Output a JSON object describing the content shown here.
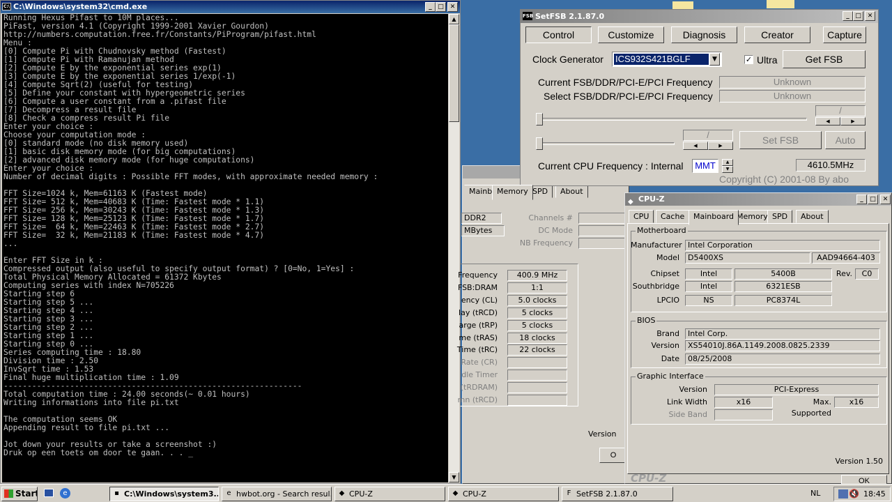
{
  "cmd": {
    "title": "C:\\Windows\\system32\\cmd.exe",
    "lines": [
      "Running Hexus Pifast to 10M places...",
      "PiFast, version 4.1 (Copyright 1999-2001 Xavier Gourdon)",
      "http://numbers.computation.free.fr/Constants/PiProgram/pifast.html",
      "Menu :",
      "[0] Compute Pi with Chudnovsky method (Fastest)",
      "[1] Compute Pi with Ramanujan method",
      "[2] Compute E by the exponential series exp(1)",
      "[3] Compute E by the exponential series 1/exp(-1)",
      "[4] Compute Sqrt(2) (useful for testing)",
      "[5] Define your constant with hypergeometric series",
      "[6] Compute a user constant from a .pifast file",
      "[7] Decompress a result file",
      "[8] Check a compress result Pi file",
      "Enter your choice :",
      "Choose your computation mode :",
      "[0] standard mode (no disk memory used)",
      "[1] basic disk memory mode (for big computations)",
      "[2] advanced disk memory mode (for huge computations)",
      "Enter your choice :",
      "Number of decimal digits : Possible FFT modes, with approximate needed memory :",
      "",
      "FFT Size=1024 k, Mem=61163 K (Fastest mode)",
      "FFT Size= 512 k, Mem=40683 K (Time: Fastest mode * 1.1)",
      "FFT Size= 256 k, Mem=30243 K (Time: Fastest mode * 1.3)",
      "FFT Size= 128 k, Mem=25123 K (Time: Fastest mode * 1.7)",
      "FFT Size=  64 k, Mem=22463 K (Time: Fastest mode * 2.7)",
      "FFT Size=  32 k, Mem=21183 K (Time: Fastest mode * 4.7)",
      "...",
      "",
      "Enter FFT Size in k :",
      "Compressed output (also useful to specify output format) ? [0=No, 1=Yes] :",
      "Total Physical Memory Allocated = 61372 Kbytes",
      "Computing series with index N=705226",
      "Starting step 6",
      "Starting step 5 ...",
      "Starting step 4 ...",
      "Starting step 3 ...",
      "Starting step 2 ...",
      "Starting step 1 ...",
      "Starting step 0 ...",
      "Series computing time : 18.80",
      "Division time : 2.50",
      "InvSqrt time : 1.53",
      "Final huge multiplication time : 1.09",
      "---------------------------------------------------------------",
      "Total computation time : 24.00 seconds(~ 0.01 hours)",
      "Writing informations into file pi.txt",
      "",
      "The computation seems OK",
      "Appending result to file pi.txt ...",
      "",
      "Jot down your results or take a screenshot :)",
      "Druk op een toets om door te gaan. . . _"
    ]
  },
  "setfsb": {
    "title": "SetFSB 2.1.87.0",
    "tabs": [
      "Control",
      "Customize",
      "Diagnosis",
      "Creator",
      "Capture"
    ],
    "clock_label": "Clock Generator",
    "clock_value": "ICS932S421BGLF",
    "ultra_label": "Ultra",
    "get_fsb": "Get FSB",
    "current_label": "Current FSB/DDR/PCI-E/PCI Frequency",
    "current_value": "Unknown",
    "select_label": "Select FSB/DDR/PCI-E/PCI Frequency",
    "select_value": "Unknown",
    "slash": "/",
    "set_fsb": "Set FSB",
    "auto": "Auto",
    "cpu_label": "Current CPU Frequency : Internal",
    "mmt": "MMT",
    "cpu_value": "4610.5MHz",
    "copyright": "Copyright (C) 2001-08 By abo"
  },
  "cpuz_back": {
    "tabs": [
      "Mainboard",
      "Memory",
      "SPD",
      "About"
    ],
    "type": "DDR2",
    "size": "MBytes",
    "channels_label": "Channels #",
    "dcmode_label": "DC Mode",
    "nbfreq_label": "NB Frequency",
    "rows": [
      {
        "label": "Frequency",
        "value": "400.9 MHz"
      },
      {
        "label": "FSB:DRAM",
        "value": "1:1"
      },
      {
        "label": "ency (CL)",
        "value": "5.0 clocks"
      },
      {
        "label": "lay (tRCD)",
        "value": "5 clocks"
      },
      {
        "label": "arge (tRP)",
        "value": "5 clocks"
      },
      {
        "label": "me (tRAS)",
        "value": "18 clocks"
      },
      {
        "label": "Time (tRC)",
        "value": "22 clocks"
      },
      {
        "label": "Rate (CR)",
        "value": ""
      },
      {
        "label": "Idle Timer",
        "value": ""
      },
      {
        "label": "(tRDRAM)",
        "value": ""
      },
      {
        "label": "mn (tRCD)",
        "value": ""
      }
    ],
    "version_label": "Version",
    "ok_partial": "O"
  },
  "cpuz": {
    "title": "CPU-Z",
    "tabs": [
      "CPU",
      "Cache",
      "Mainboard",
      "Memory",
      "SPD",
      "About"
    ],
    "motherboard": {
      "group": "Motherboard",
      "manufacturer_label": "Manufacturer",
      "manufacturer": "Intel Corporation",
      "model_label": "Model",
      "model": "D5400XS",
      "model_rev": "AAD94664-403",
      "chipset_label": "Chipset",
      "chipset_vendor": "Intel",
      "chipset": "5400B",
      "rev_label": "Rev.",
      "rev": "C0",
      "south_label": "Southbridge",
      "south_vendor": "Intel",
      "south": "6321ESB",
      "lpcio_label": "LPCIO",
      "lpcio_vendor": "NS",
      "lpcio": "PC8374L"
    },
    "bios": {
      "group": "BIOS",
      "brand_label": "Brand",
      "brand": "Intel Corp.",
      "version_label": "Version",
      "version": "XS54010J.86A.1149.2008.0825.2339",
      "date_label": "Date",
      "date": "08/25/2008"
    },
    "graphic": {
      "group": "Graphic Interface",
      "version_label": "Version",
      "version": "PCI-Express",
      "link_label": "Link Width",
      "link": "x16",
      "max_label": "Max. Supported",
      "max": "x16",
      "side_label": "Side Band",
      "side": ""
    },
    "footer_version": "Version 1.50",
    "logo": "CPU-Z",
    "ok": "OK"
  },
  "taskbar": {
    "start": "Start",
    "buttons": [
      {
        "label": "C:\\Windows\\system3...",
        "icon": "cmd-icon"
      },
      {
        "label": "hwbot.org - Search resul...",
        "icon": "browser-icon"
      },
      {
        "label": "CPU-Z",
        "icon": "cpuz-icon"
      },
      {
        "label": "CPU-Z",
        "icon": "cpuz-icon"
      },
      {
        "label": "SetFSB 2.1.87.0",
        "icon": "setfsb-icon"
      }
    ],
    "lang": "NL",
    "clock": "18:45"
  },
  "colors": {
    "desktop": "#3a6ea5",
    "console_bg": "#000000",
    "console_fg": "#c0c0c0",
    "title_active": "#0a246a",
    "accent_blue": "#0000cc"
  }
}
